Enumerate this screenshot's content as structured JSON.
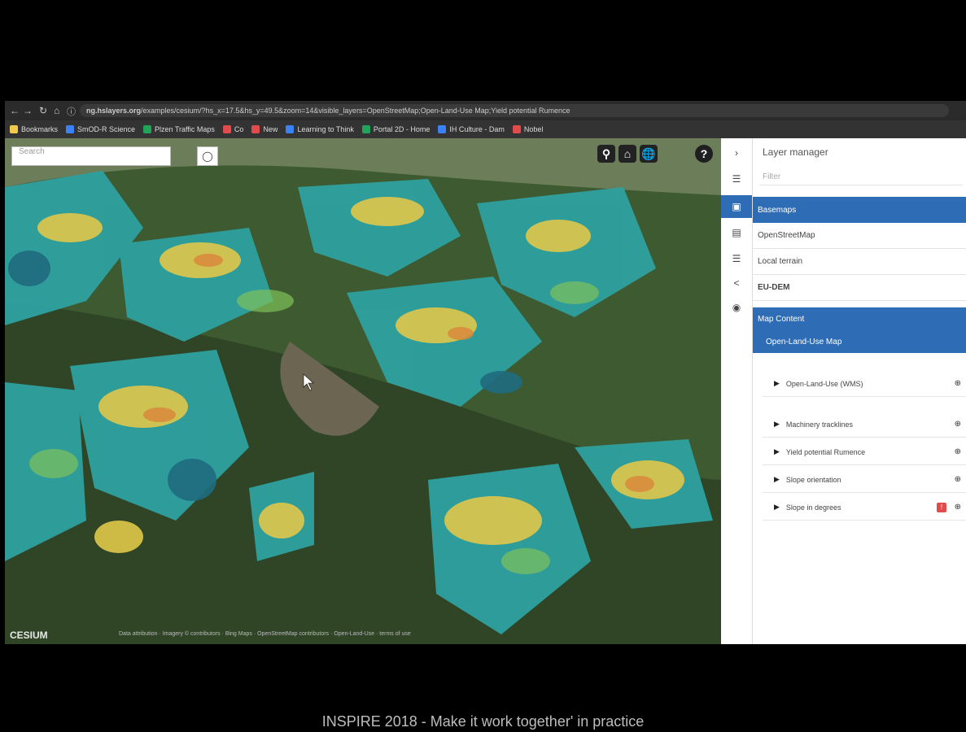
{
  "browser": {
    "url": "ng.hslayers.org",
    "url_tail": "/examples/cesium/?hs_x=17.5&hs_y=49.5&zoom=14&visible_layers=OpenStreetMap;Open-Land-Use Map;Yield potential Rumence",
    "bookmarks": [
      {
        "label": "Bookmarks",
        "color": "#f2c94c"
      },
      {
        "label": "SmOD-R Science",
        "color": "#3b82f6"
      },
      {
        "label": "Plzen Traffic Maps",
        "color": "#22a35a"
      },
      {
        "label": "Co",
        "color": "#e24b4b"
      },
      {
        "label": "New",
        "color": "#e24b4b"
      },
      {
        "label": "Learning to Think",
        "color": "#3b82f6"
      },
      {
        "label": "Portal 2D - Home",
        "color": "#22a35a"
      },
      {
        "label": "IH Culture - Dam",
        "color": "#3b82f6"
      },
      {
        "label": "Nobel",
        "color": "#e24b4b"
      }
    ]
  },
  "map": {
    "search_placeholder": "Search",
    "cesium_logo": "CESIUM",
    "attribution": "Data attribution · Imagery © contributors · Bing Maps · OpenStreetMap contributors · Open-Land-Use · terms of use"
  },
  "panel": {
    "title": "Layer manager",
    "filter_placeholder": "Filter",
    "rows": [
      {
        "label": "Basemaps",
        "style": "blue"
      },
      {
        "label": "OpenStreetMap",
        "style": "normal"
      },
      {
        "label": "Local terrain",
        "style": "normal"
      },
      {
        "label": "EU-DEM",
        "style": "bold"
      },
      {
        "label": "Map Content",
        "style": "blue"
      },
      {
        "label": "Open-Land-Use Map",
        "style": "blue"
      }
    ],
    "sublayers": [
      {
        "label": "Open-Land-Use (WMS)"
      },
      {
        "label": "Machinery tracklines"
      },
      {
        "label": "Yield potential Rumence"
      },
      {
        "label": "Slope orientation"
      },
      {
        "label": "Slope in degrees"
      }
    ]
  },
  "caption": "INSPIRE 2018 - Make it work together' in practice"
}
